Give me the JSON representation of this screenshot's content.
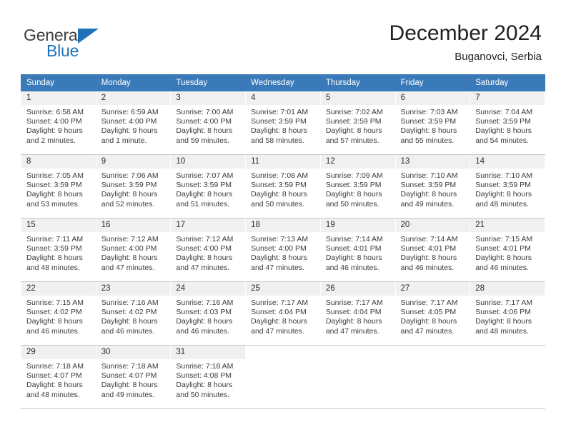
{
  "brand": {
    "word_top": "General",
    "word_bottom": "Blue",
    "triangle_color": "#1e72b8",
    "icon": "triangle-logo-icon"
  },
  "header": {
    "title": "December 2024",
    "subtitle": "Buganovci, Serbia"
  },
  "calendar": {
    "header_bg": "#3a7ab8",
    "header_text_color": "#ffffff",
    "daynum_bg": "#f0f0f0",
    "weekdays": [
      "Sunday",
      "Monday",
      "Tuesday",
      "Wednesday",
      "Thursday",
      "Friday",
      "Saturday"
    ],
    "weeks": [
      [
        {
          "day": "1",
          "sunrise": "Sunrise: 6:58 AM",
          "sunset": "Sunset: 4:00 PM",
          "daylight": "Daylight: 9 hours and 2 minutes."
        },
        {
          "day": "2",
          "sunrise": "Sunrise: 6:59 AM",
          "sunset": "Sunset: 4:00 PM",
          "daylight": "Daylight: 9 hours and 1 minute."
        },
        {
          "day": "3",
          "sunrise": "Sunrise: 7:00 AM",
          "sunset": "Sunset: 4:00 PM",
          "daylight": "Daylight: 8 hours and 59 minutes."
        },
        {
          "day": "4",
          "sunrise": "Sunrise: 7:01 AM",
          "sunset": "Sunset: 3:59 PM",
          "daylight": "Daylight: 8 hours and 58 minutes."
        },
        {
          "day": "5",
          "sunrise": "Sunrise: 7:02 AM",
          "sunset": "Sunset: 3:59 PM",
          "daylight": "Daylight: 8 hours and 57 minutes."
        },
        {
          "day": "6",
          "sunrise": "Sunrise: 7:03 AM",
          "sunset": "Sunset: 3:59 PM",
          "daylight": "Daylight: 8 hours and 55 minutes."
        },
        {
          "day": "7",
          "sunrise": "Sunrise: 7:04 AM",
          "sunset": "Sunset: 3:59 PM",
          "daylight": "Daylight: 8 hours and 54 minutes."
        }
      ],
      [
        {
          "day": "8",
          "sunrise": "Sunrise: 7:05 AM",
          "sunset": "Sunset: 3:59 PM",
          "daylight": "Daylight: 8 hours and 53 minutes."
        },
        {
          "day": "9",
          "sunrise": "Sunrise: 7:06 AM",
          "sunset": "Sunset: 3:59 PM",
          "daylight": "Daylight: 8 hours and 52 minutes."
        },
        {
          "day": "10",
          "sunrise": "Sunrise: 7:07 AM",
          "sunset": "Sunset: 3:59 PM",
          "daylight": "Daylight: 8 hours and 51 minutes."
        },
        {
          "day": "11",
          "sunrise": "Sunrise: 7:08 AM",
          "sunset": "Sunset: 3:59 PM",
          "daylight": "Daylight: 8 hours and 50 minutes."
        },
        {
          "day": "12",
          "sunrise": "Sunrise: 7:09 AM",
          "sunset": "Sunset: 3:59 PM",
          "daylight": "Daylight: 8 hours and 50 minutes."
        },
        {
          "day": "13",
          "sunrise": "Sunrise: 7:10 AM",
          "sunset": "Sunset: 3:59 PM",
          "daylight": "Daylight: 8 hours and 49 minutes."
        },
        {
          "day": "14",
          "sunrise": "Sunrise: 7:10 AM",
          "sunset": "Sunset: 3:59 PM",
          "daylight": "Daylight: 8 hours and 48 minutes."
        }
      ],
      [
        {
          "day": "15",
          "sunrise": "Sunrise: 7:11 AM",
          "sunset": "Sunset: 3:59 PM",
          "daylight": "Daylight: 8 hours and 48 minutes."
        },
        {
          "day": "16",
          "sunrise": "Sunrise: 7:12 AM",
          "sunset": "Sunset: 4:00 PM",
          "daylight": "Daylight: 8 hours and 47 minutes."
        },
        {
          "day": "17",
          "sunrise": "Sunrise: 7:12 AM",
          "sunset": "Sunset: 4:00 PM",
          "daylight": "Daylight: 8 hours and 47 minutes."
        },
        {
          "day": "18",
          "sunrise": "Sunrise: 7:13 AM",
          "sunset": "Sunset: 4:00 PM",
          "daylight": "Daylight: 8 hours and 47 minutes."
        },
        {
          "day": "19",
          "sunrise": "Sunrise: 7:14 AM",
          "sunset": "Sunset: 4:01 PM",
          "daylight": "Daylight: 8 hours and 46 minutes."
        },
        {
          "day": "20",
          "sunrise": "Sunrise: 7:14 AM",
          "sunset": "Sunset: 4:01 PM",
          "daylight": "Daylight: 8 hours and 46 minutes."
        },
        {
          "day": "21",
          "sunrise": "Sunrise: 7:15 AM",
          "sunset": "Sunset: 4:01 PM",
          "daylight": "Daylight: 8 hours and 46 minutes."
        }
      ],
      [
        {
          "day": "22",
          "sunrise": "Sunrise: 7:15 AM",
          "sunset": "Sunset: 4:02 PM",
          "daylight": "Daylight: 8 hours and 46 minutes."
        },
        {
          "day": "23",
          "sunrise": "Sunrise: 7:16 AM",
          "sunset": "Sunset: 4:02 PM",
          "daylight": "Daylight: 8 hours and 46 minutes."
        },
        {
          "day": "24",
          "sunrise": "Sunrise: 7:16 AM",
          "sunset": "Sunset: 4:03 PM",
          "daylight": "Daylight: 8 hours and 46 minutes."
        },
        {
          "day": "25",
          "sunrise": "Sunrise: 7:17 AM",
          "sunset": "Sunset: 4:04 PM",
          "daylight": "Daylight: 8 hours and 47 minutes."
        },
        {
          "day": "26",
          "sunrise": "Sunrise: 7:17 AM",
          "sunset": "Sunset: 4:04 PM",
          "daylight": "Daylight: 8 hours and 47 minutes."
        },
        {
          "day": "27",
          "sunrise": "Sunrise: 7:17 AM",
          "sunset": "Sunset: 4:05 PM",
          "daylight": "Daylight: 8 hours and 47 minutes."
        },
        {
          "day": "28",
          "sunrise": "Sunrise: 7:17 AM",
          "sunset": "Sunset: 4:06 PM",
          "daylight": "Daylight: 8 hours and 48 minutes."
        }
      ],
      [
        {
          "day": "29",
          "sunrise": "Sunrise: 7:18 AM",
          "sunset": "Sunset: 4:07 PM",
          "daylight": "Daylight: 8 hours and 48 minutes."
        },
        {
          "day": "30",
          "sunrise": "Sunrise: 7:18 AM",
          "sunset": "Sunset: 4:07 PM",
          "daylight": "Daylight: 8 hours and 49 minutes."
        },
        {
          "day": "31",
          "sunrise": "Sunrise: 7:18 AM",
          "sunset": "Sunset: 4:08 PM",
          "daylight": "Daylight: 8 hours and 50 minutes."
        },
        {
          "day": "",
          "sunrise": "",
          "sunset": "",
          "daylight": ""
        },
        {
          "day": "",
          "sunrise": "",
          "sunset": "",
          "daylight": ""
        },
        {
          "day": "",
          "sunrise": "",
          "sunset": "",
          "daylight": ""
        },
        {
          "day": "",
          "sunrise": "",
          "sunset": "",
          "daylight": ""
        }
      ]
    ]
  }
}
